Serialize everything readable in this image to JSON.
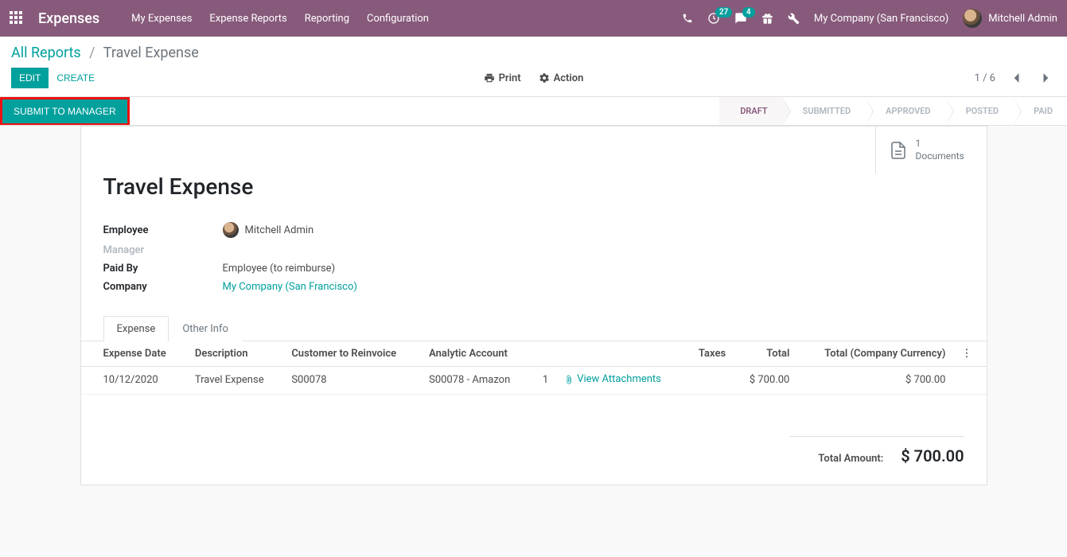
{
  "navbar": {
    "brand": "Expenses",
    "menu": [
      "My Expenses",
      "Expense Reports",
      "Reporting",
      "Configuration"
    ],
    "activity_badge": "27",
    "chat_badge": "4",
    "company": "My Company (San Francisco)",
    "user": "Mitchell Admin"
  },
  "breadcrumb": {
    "root": "All Reports",
    "sep": "/",
    "current": "Travel Expense"
  },
  "buttons": {
    "edit": "EDIT",
    "create": "CREATE",
    "print": "Print",
    "action": "Action",
    "submit": "SUBMIT TO MANAGER"
  },
  "pager": {
    "text": "1 / 6"
  },
  "statusbar": [
    "DRAFT",
    "SUBMITTED",
    "APPROVED",
    "POSTED",
    "PAID"
  ],
  "documents": {
    "count": "1",
    "label": "Documents"
  },
  "form": {
    "title": "Travel Expense",
    "employee_label": "Employee",
    "employee_value": "Mitchell Admin",
    "manager_label": "Manager",
    "paidby_label": "Paid By",
    "paidby_value": "Employee (to reimburse)",
    "company_label": "Company",
    "company_value": "My Company (San Francisco)"
  },
  "tabs": {
    "expense": "Expense",
    "other": "Other Info"
  },
  "table": {
    "headers": {
      "date": "Expense Date",
      "desc": "Description",
      "cust": "Customer to Reinvoice",
      "analytic": "Analytic Account",
      "taxes": "Taxes",
      "total": "Total",
      "total_cc": "Total (Company Currency)"
    },
    "row": {
      "date": "10/12/2020",
      "desc": "Travel Expense",
      "cust": "S00078",
      "analytic": "S00078 - Amazon",
      "att_count": "1",
      "att_label": "View Attachments",
      "total": "$ 700.00",
      "total_cc": "$ 700.00"
    }
  },
  "totals": {
    "label": "Total Amount:",
    "value": "$ 700.00"
  }
}
